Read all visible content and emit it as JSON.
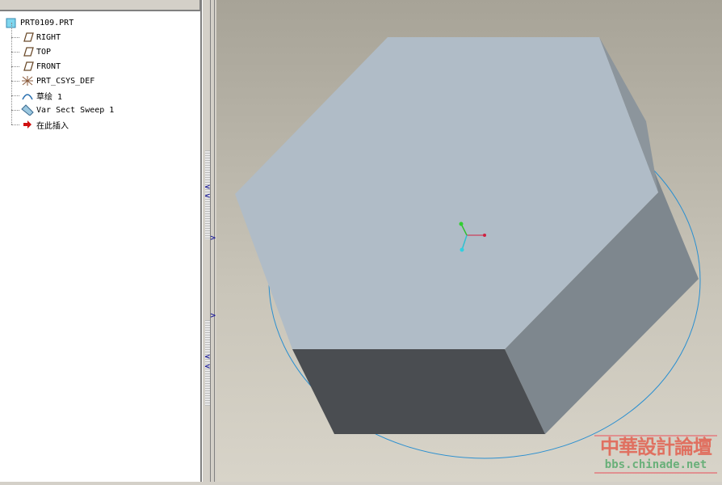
{
  "model_tree": {
    "root": "PRT0109.PRT",
    "items": [
      {
        "label": "RIGHT",
        "icon": "datum-plane-icon"
      },
      {
        "label": "TOP",
        "icon": "datum-plane-icon"
      },
      {
        "label": "FRONT",
        "icon": "datum-plane-icon"
      },
      {
        "label": "PRT_CSYS_DEF",
        "icon": "coordinate-system-icon"
      },
      {
        "label": "草绘 1",
        "icon": "sketch-icon"
      },
      {
        "label": "Var Sect Sweep 1",
        "icon": "sweep-feature-icon"
      },
      {
        "label": "在此插入",
        "icon": "insert-here-arrow-icon"
      }
    ]
  },
  "watermark": {
    "title": "中華設計論壇",
    "url": "bbs.chinade.net"
  },
  "colors": {
    "top_face": "#b0bcc7",
    "side_face": "#7e878e",
    "front_face": "#4a4d51",
    "trajectory": "#2a8fd0"
  }
}
